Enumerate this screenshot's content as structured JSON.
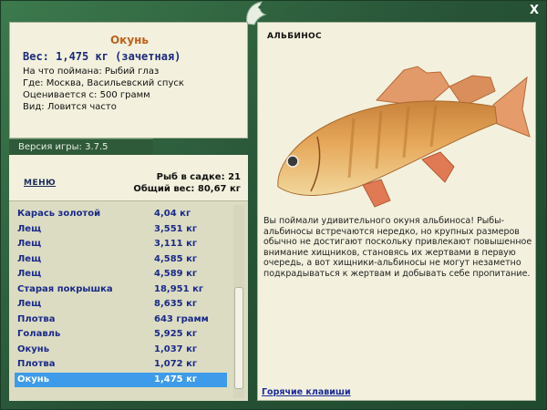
{
  "info": {
    "title": "Окунь",
    "weight": "Вес: 1,475 кг (зачетная)",
    "bait": "На что поймана: Рыбий глаз",
    "place": "Где: Москва, Васильевский спуск",
    "value": "Оценивается с: 500 грамм",
    "kind": "Вид: Ловится часто"
  },
  "version": "Версия игры: 3.7.5",
  "menu_label": "МЕНЮ",
  "stats": {
    "count": "Рыб в садке: 21",
    "total": "Общий вес: 80,67 кг"
  },
  "catch_list": [
    {
      "name": "Карась золотой",
      "weight": "4,04 кг"
    },
    {
      "name": "Лещ",
      "weight": "3,551 кг"
    },
    {
      "name": "Лещ",
      "weight": "3,111 кг"
    },
    {
      "name": "Лещ",
      "weight": "4,585 кг"
    },
    {
      "name": "Лещ",
      "weight": "4,589 кг"
    },
    {
      "name": "Старая покрышка",
      "weight": "18,951 кг"
    },
    {
      "name": "Лещ",
      "weight": "8,635 кг"
    },
    {
      "name": "Плотва",
      "weight": "643 грамм"
    },
    {
      "name": "Голавль",
      "weight": "5,925 кг"
    },
    {
      "name": "Окунь",
      "weight": "1,037 кг"
    },
    {
      "name": "Плотва",
      "weight": "1,072 кг"
    },
    {
      "name": "Окунь",
      "weight": "1,475 кг"
    }
  ],
  "selected_index": 11,
  "right": {
    "fish_kind": "АЛЬБИНОС",
    "description": "Вы поймали удивительного окуня альбиноса! Рыбы-альбиносы встречаются нередко, но крупных размеров обычно не достигают поскольку привлекают повышенное внимание хищников, становясь их жертвами в первую очередь, а вот хищники-альбиносы не могут незаметно подкрадываться к жертвам и добывать себе пропитание.",
    "hotkeys": "Горячие клавиши"
  },
  "close_label": "X",
  "colors": {
    "frame": "#2d5e3c",
    "panel": "#f3f1dd",
    "list_bg": "#dcdcc2",
    "list_text": "#1a2a8a",
    "selected_row": "#3d9bea",
    "title_orange": "#c0611c"
  }
}
